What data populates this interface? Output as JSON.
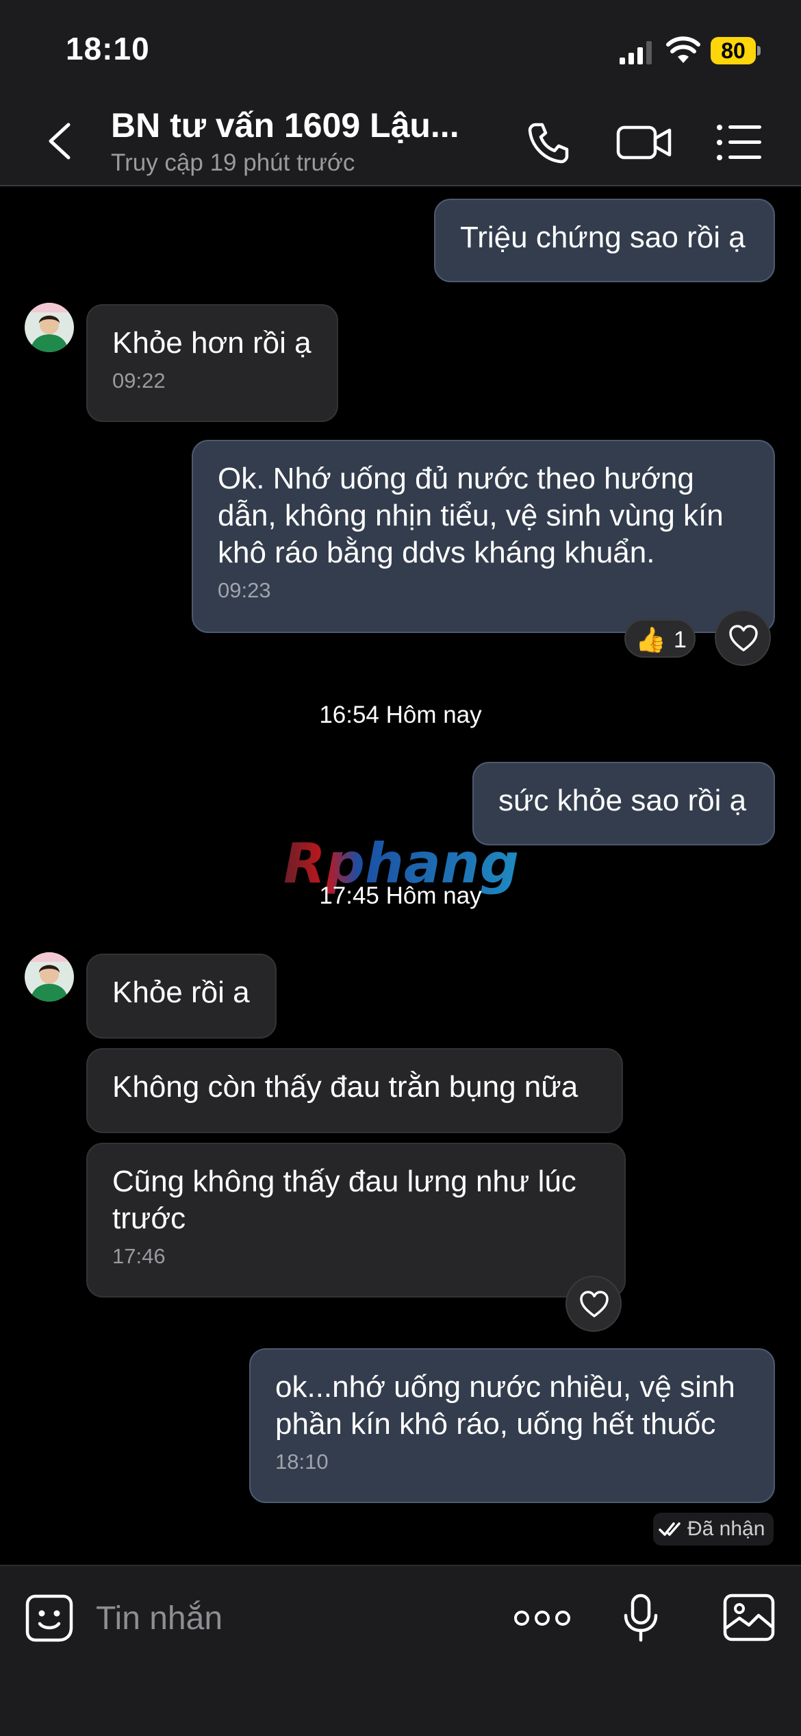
{
  "status_bar": {
    "time": "18:10",
    "battery": "80"
  },
  "header": {
    "title": "BN tư vấn 1609 Lậu...",
    "subtitle": "Truy cập 19 phút trước",
    "icons": [
      "back-chevron-icon",
      "phone-icon",
      "video-camera-icon",
      "list-menu-icon"
    ]
  },
  "messages": [
    {
      "direction": "out",
      "text": "Triệu chứng sao rồi ạ"
    },
    {
      "direction": "in",
      "text": "Khỏe hơn rồi ạ",
      "time": "09:22"
    },
    {
      "direction": "out",
      "text": "Ok. Nhớ uống đủ nước theo hướng dẫn, không nhịn tiểu, vệ sinh vùng kín khô ráo bằng ddvs kháng khuẩn.",
      "time": "09:23",
      "reaction": {
        "emoji": "👍",
        "count": "1"
      }
    },
    {
      "direction": "out",
      "text": "sức khỏe sao rồi ạ"
    },
    {
      "direction": "in",
      "text": "Khỏe rồi a"
    },
    {
      "direction": "in",
      "text": "Không còn thấy đau trằn bụng nữa"
    },
    {
      "direction": "in",
      "text": "Cũng không thấy đau lưng như lúc trước",
      "time": "17:46"
    },
    {
      "direction": "out",
      "text": "ok...nhớ uống nước nhiều, vệ sinh phần kín khô ráo, uống hết thuốc",
      "time": "18:10"
    }
  ],
  "separators": [
    "16:54 Hôm nay",
    "17:45 Hôm nay"
  ],
  "watermark": "Rphang",
  "receipt": "Đã nhận",
  "composer": {
    "placeholder": "Tin nhắn",
    "icons": [
      "emoji-sticker-icon",
      "more-dots-icon",
      "microphone-icon",
      "gallery-icon"
    ]
  },
  "colors": {
    "background": "#000000",
    "bar_background": "#1c1c1e",
    "outgoing_bubble": "#333d4d",
    "incoming_bubble": "#262628",
    "battery_accent": "#ffd60a"
  }
}
